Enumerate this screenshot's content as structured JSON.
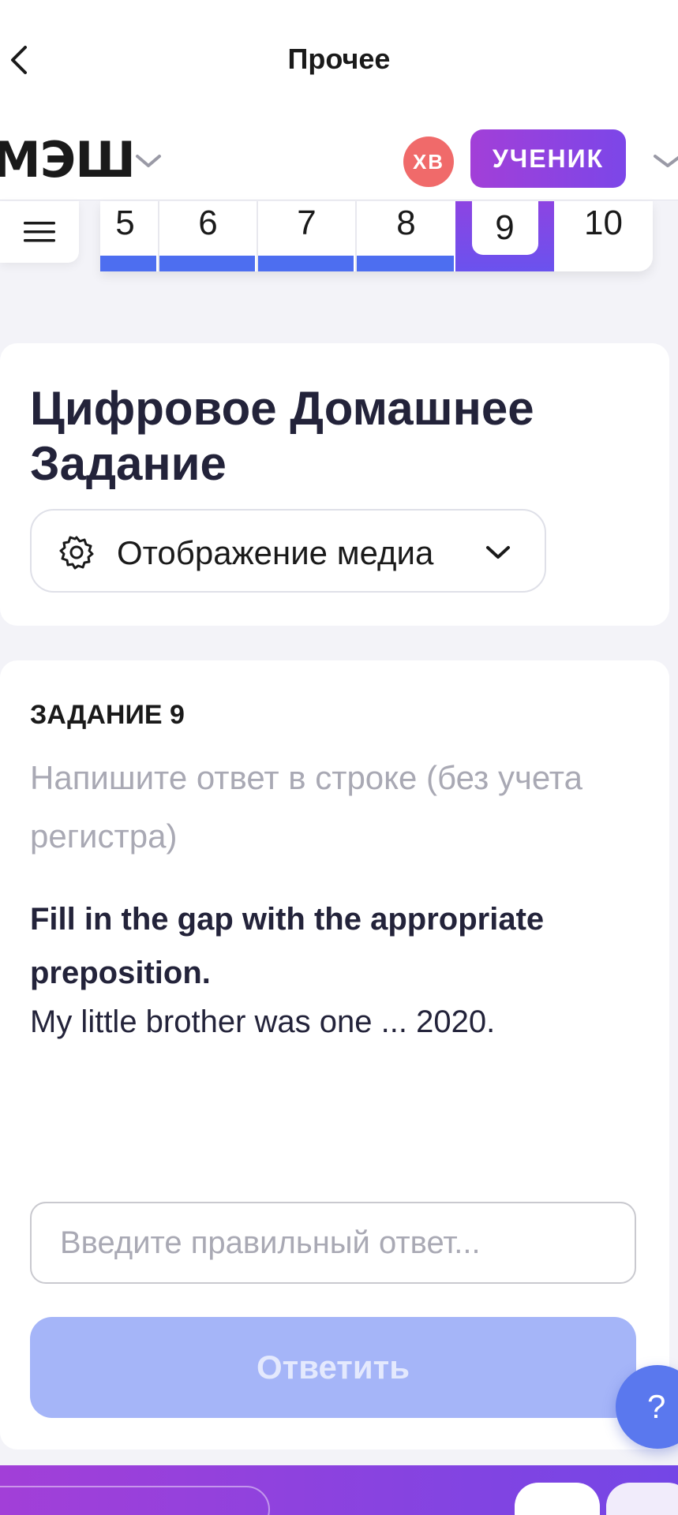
{
  "topbar": {
    "title": "Прочее"
  },
  "header": {
    "logo": "МЭШ",
    "avatar_initials": "ХВ",
    "role_badge": "УЧЕНИК"
  },
  "task_nav": {
    "items": [
      {
        "label": "5",
        "state": "done"
      },
      {
        "label": "6",
        "state": "done"
      },
      {
        "label": "7",
        "state": "done"
      },
      {
        "label": "8",
        "state": "done"
      },
      {
        "label": "9",
        "state": "current"
      },
      {
        "label": "10",
        "state": "pending"
      }
    ]
  },
  "homework": {
    "title": "Цифровое Домашнее Задание",
    "media_select_label": "Отображение медиа"
  },
  "task": {
    "label": "ЗАДАНИЕ 9",
    "hint": "Напишите ответ в строке (без учета регистра)",
    "instruction": "Fill in the gap with the appropriate preposition.",
    "sentence": "My little brother was one ... 2020.",
    "input_placeholder": "Введите правильный ответ...",
    "submit_label": "Ответить"
  },
  "help": {
    "label": "?"
  },
  "colors": {
    "accent_purple": "#8d44e2",
    "progress_blue": "#4d6ef0",
    "submit_disabled": "#a5b5f8",
    "avatar": "#f06a6a"
  }
}
